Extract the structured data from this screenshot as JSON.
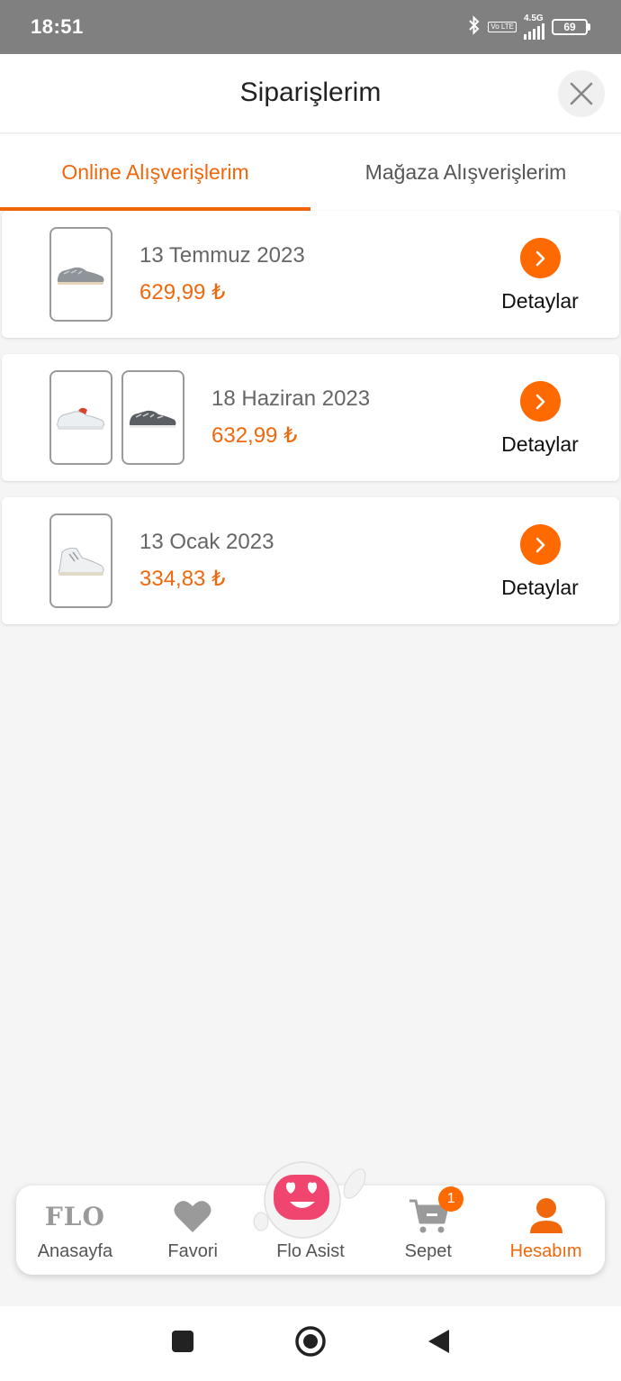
{
  "status_bar": {
    "time": "18:51",
    "network": "4.5G",
    "volte": "Vo LTE",
    "battery": "69",
    "icons": [
      "bluetooth-icon",
      "volte-icon",
      "signal-icon",
      "battery-icon"
    ]
  },
  "header": {
    "title": "Siparişlerim",
    "close_icon": "close-icon"
  },
  "tabs": [
    {
      "label": "Online Alışverişlerim",
      "active": true
    },
    {
      "label": "Mağaza Alışverişlerim",
      "active": false
    }
  ],
  "orders": [
    {
      "date": "13 Temmuz 2023",
      "price": "629,99 ₺",
      "details_label": "Detaylar",
      "thumbnails": [
        "grey-sneaker"
      ]
    },
    {
      "date": "18 Haziran 2023",
      "price": "632,99 ₺",
      "details_label": "Detaylar",
      "thumbnails": [
        "white-red-sneaker",
        "grey-sneaker"
      ]
    },
    {
      "date": "13 Ocak 2023",
      "price": "334,83 ₺",
      "details_label": "Detaylar",
      "thumbnails": [
        "white-high-top-sneaker"
      ]
    }
  ],
  "bottom_nav": {
    "items": [
      {
        "label": "Anasayfa",
        "logo_text": "FLO",
        "icon": "flo-logo-icon"
      },
      {
        "label": "Favori",
        "icon": "heart-icon"
      },
      {
        "label": "Flo Asist",
        "icon": "mascot-icon"
      },
      {
        "label": "Sepet",
        "icon": "cart-icon",
        "badge": "1"
      },
      {
        "label": "Hesabım",
        "icon": "user-icon",
        "active": true
      }
    ]
  },
  "system_nav": [
    "recents-icon",
    "home-icon",
    "back-icon"
  ],
  "colors": {
    "accent": "#f0670c",
    "button_orange": "#ff6a00",
    "status_bar": "#808080",
    "background": "#f5f5f5"
  }
}
